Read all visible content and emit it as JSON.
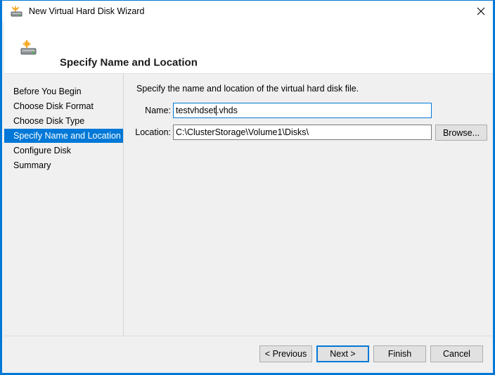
{
  "window": {
    "title": "New Virtual Hard Disk Wizard",
    "icon": "hard-disk-new-icon",
    "close_label": "✕",
    "accent_color": "#0078d7"
  },
  "header": {
    "title": "Specify Name and Location",
    "icon": "hard-disk-new-icon"
  },
  "sidebar": {
    "items": [
      {
        "label": "Before You Begin",
        "selected": false
      },
      {
        "label": "Choose Disk Format",
        "selected": false
      },
      {
        "label": "Choose Disk Type",
        "selected": false
      },
      {
        "label": "Specify Name and Location",
        "selected": true
      },
      {
        "label": "Configure Disk",
        "selected": false
      },
      {
        "label": "Summary",
        "selected": false
      }
    ]
  },
  "main": {
    "instruction": "Specify the name and location of the virtual hard disk file.",
    "name_field": {
      "label": "Name:",
      "value_before_caret": "testvhdset",
      "value_after_caret": ".vhds",
      "value": "testvhdset.vhds",
      "focused": true
    },
    "location_field": {
      "label": "Location:",
      "value": "C:\\ClusterStorage\\Volume1\\Disks\\",
      "focused": false
    },
    "browse_button": "Browse..."
  },
  "footer": {
    "previous": "< Previous",
    "next": "Next >",
    "finish": "Finish",
    "cancel": "Cancel"
  }
}
